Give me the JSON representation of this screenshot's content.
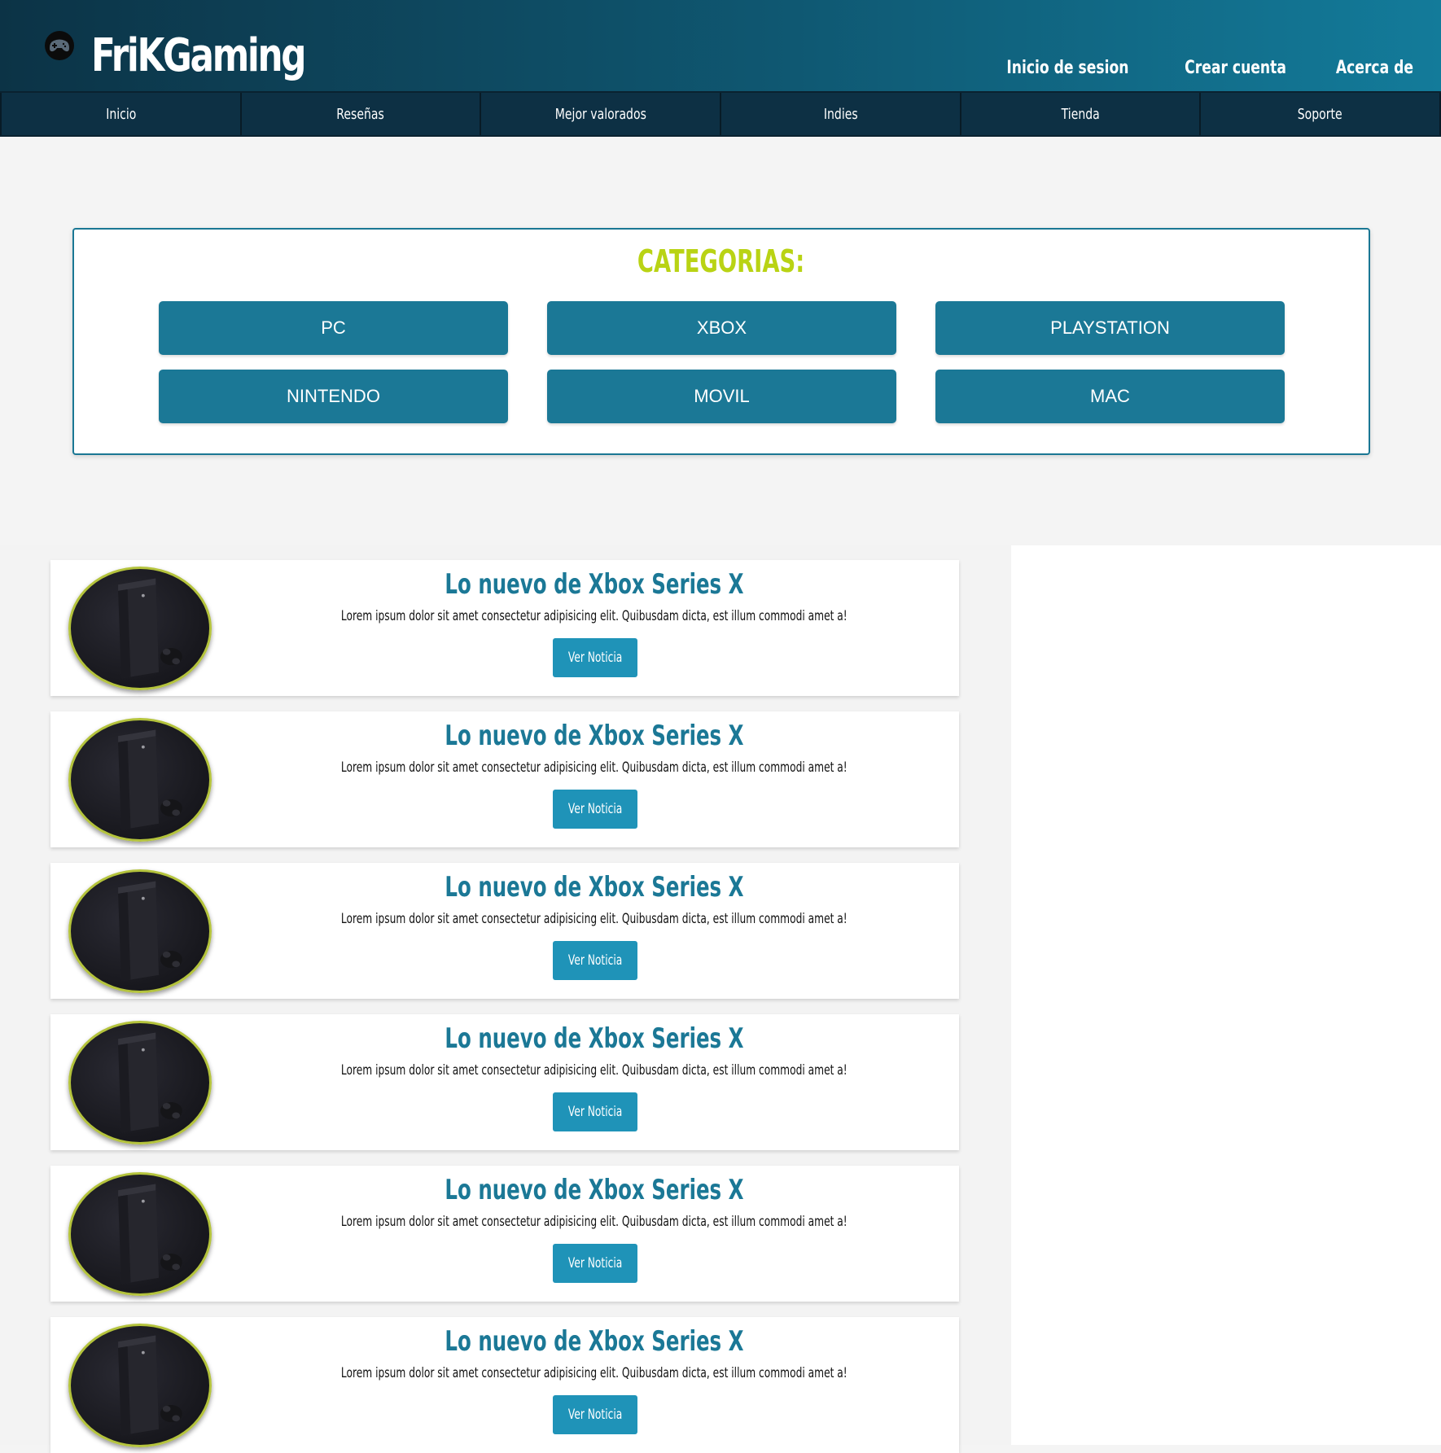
{
  "header": {
    "brand": "FriKGaming",
    "logo_icon": "gamepad-icon",
    "links": [
      "Inicio de sesion",
      "Crear cuenta",
      "Acerca de"
    ]
  },
  "nav": {
    "items": [
      "Inicio",
      "Reseñas",
      "Mejor valorados",
      "Indies",
      "Tienda",
      "Soporte"
    ]
  },
  "categories": {
    "title": "CATEGORIAS:",
    "buttons": [
      "PC",
      "XBOX",
      "PLAYSTATION",
      "NINTENDO",
      "MOVIL",
      "MAC"
    ]
  },
  "news": [
    {
      "title": "Lo nuevo de Xbox Series X",
      "text": "Lorem ipsum dolor sit amet consectetur adipisicing elit. Quibusdam dicta, est illum commodi amet a!",
      "button": "Ver Noticia"
    },
    {
      "title": "Lo nuevo de Xbox Series X",
      "text": "Lorem ipsum dolor sit amet consectetur adipisicing elit. Quibusdam dicta, est illum commodi amet a!",
      "button": "Ver Noticia"
    },
    {
      "title": "Lo nuevo de Xbox Series X",
      "text": "Lorem ipsum dolor sit amet consectetur adipisicing elit. Quibusdam dicta, est illum commodi amet a!",
      "button": "Ver Noticia"
    },
    {
      "title": "Lo nuevo de Xbox Series X",
      "text": "Lorem ipsum dolor sit amet consectetur adipisicing elit. Quibusdam dicta, est illum commodi amet a!",
      "button": "Ver Noticia"
    },
    {
      "title": "Lo nuevo de Xbox Series X",
      "text": "Lorem ipsum dolor sit amet consectetur adipisicing elit. Quibusdam dicta, est illum commodi amet a!",
      "button": "Ver Noticia"
    },
    {
      "title": "Lo nuevo de Xbox Series X",
      "text": "Lorem ipsum dolor sit amet consectetur adipisicing elit. Quibusdam dicta, est illum commodi amet a!",
      "button": "Ver Noticia"
    }
  ],
  "colors": {
    "header_dark": "#0c3346",
    "header_light": "#137b9a",
    "nav_bg": "#0d3044",
    "accent_lime": "#b9d314",
    "category_button": "#1b7896",
    "news_title": "#1b7896",
    "news_button": "#1f93b8"
  }
}
